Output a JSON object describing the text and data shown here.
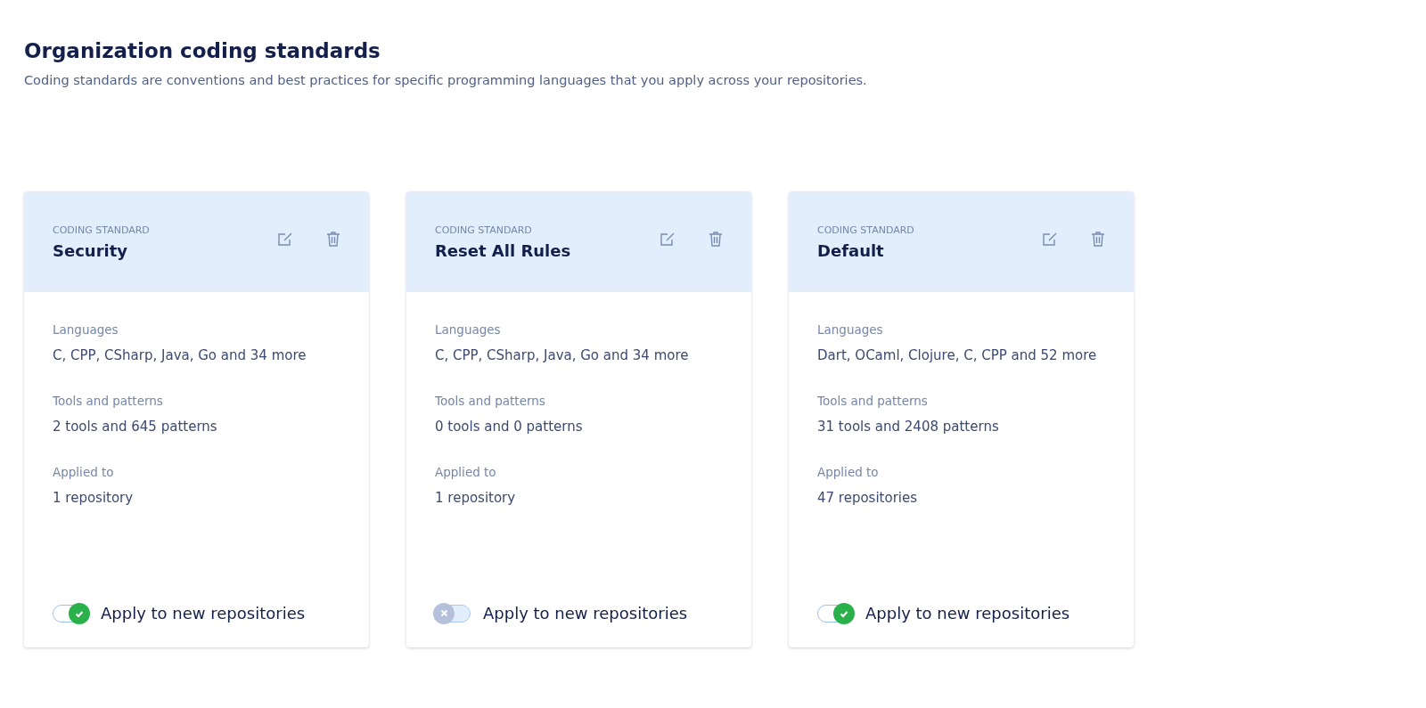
{
  "page": {
    "title": "Organization coding standards",
    "description": "Coding standards are conventions and best practices for specific programming languages that you apply across your repositories."
  },
  "cards": [
    {
      "eyebrow": "CODING STANDARD",
      "name": "Security",
      "fields": [
        {
          "label": "Languages",
          "value": "C, CPP, CSharp, Java, Go and 34 more"
        },
        {
          "label": "Tools and patterns",
          "value": "2 tools and 645 patterns"
        },
        {
          "label": "Applied to",
          "value": "1 repository"
        }
      ],
      "toggle": {
        "label": "Apply to new repositories",
        "on": true
      }
    },
    {
      "eyebrow": "CODING STANDARD",
      "name": "Reset All Rules",
      "fields": [
        {
          "label": "Languages",
          "value": "C, CPP, CSharp, Java, Go and 34 more"
        },
        {
          "label": "Tools and patterns",
          "value": "0 tools and 0 patterns"
        },
        {
          "label": "Applied to",
          "value": "1 repository"
        }
      ],
      "toggle": {
        "label": "Apply to new repositories",
        "on": false
      }
    },
    {
      "eyebrow": "CODING STANDARD",
      "name": "Default",
      "fields": [
        {
          "label": "Languages",
          "value": "Dart, OCaml, Clojure, C, CPP and 52 more"
        },
        {
          "label": "Tools and patterns",
          "value": "31 tools and 2408 patterns"
        },
        {
          "label": "Applied to",
          "value": "47 repositories"
        }
      ],
      "toggle": {
        "label": "Apply to new repositories",
        "on": true
      }
    }
  ]
}
